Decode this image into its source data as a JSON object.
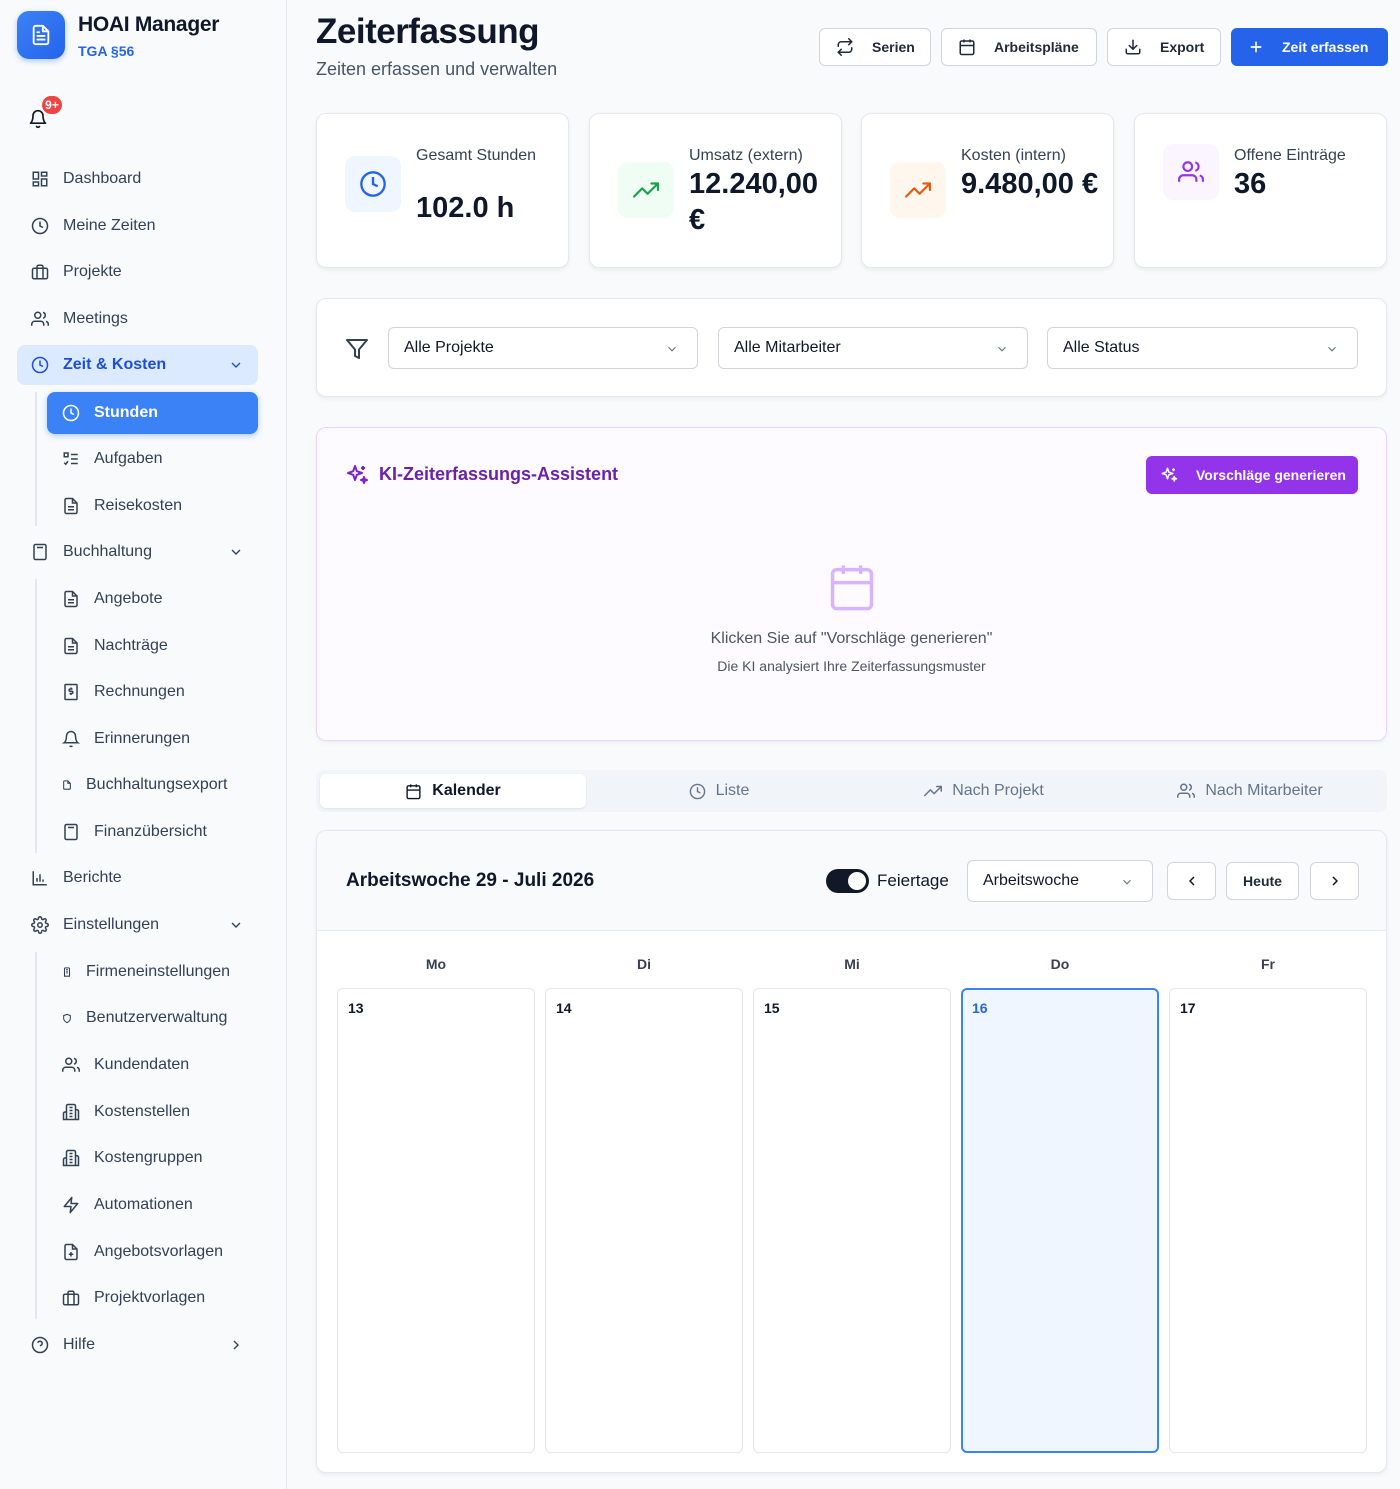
{
  "app": {
    "title": "HOAI Manager",
    "subtitle": "TGA §56",
    "notification_badge": "9+"
  },
  "sidebar": {
    "items": [
      {
        "label": "Dashboard",
        "icon": "dashboard-icon"
      },
      {
        "label": "Meine Zeiten",
        "icon": "clock-icon"
      },
      {
        "label": "Projekte",
        "icon": "briefcase-icon"
      },
      {
        "label": "Meetings",
        "icon": "users-icon"
      },
      {
        "label": "Zeit & Kosten",
        "icon": "clock-icon",
        "expanded": true
      },
      {
        "label": "Buchhaltung",
        "icon": "calculator-icon",
        "expanded": true
      },
      {
        "label": "Berichte",
        "icon": "bar-chart-icon"
      },
      {
        "label": "Einstellungen",
        "icon": "gear-icon",
        "expanded": true
      },
      {
        "label": "Hilfe",
        "icon": "help-icon"
      }
    ],
    "zeit_kosten": [
      "Stunden",
      "Aufgaben",
      "Reisekosten"
    ],
    "buchhaltung": [
      "Angebote",
      "Nachträge",
      "Rechnungen",
      "Erinnerungen",
      "Buchhaltungsexport",
      "Finanzübersicht"
    ],
    "einstellungen": [
      "Firmeneinstellungen",
      "Benutzerverwaltung",
      "Kundendaten",
      "Kostenstellen",
      "Kostengruppen",
      "Automationen",
      "Angebotsvorlagen",
      "Projektvorlagen"
    ],
    "active": "Stunden"
  },
  "header": {
    "title": "Zeiterfassung",
    "subtitle": "Zeiten erfassen und verwalten",
    "buttons": {
      "series": "Serien",
      "schedules": "Arbeitspläne",
      "export": "Export",
      "add": "Zeit erfassen"
    }
  },
  "stats": [
    {
      "label": "Gesamt Stunden",
      "value": "102.0 h",
      "color": "#2563eb"
    },
    {
      "label": "Umsatz (extern)",
      "value": "12.240,00 €",
      "color": "#16a34a"
    },
    {
      "label": "Kosten (intern)",
      "value": "9.480,00 €",
      "color": "#ea580c"
    },
    {
      "label": "Offene Einträge",
      "value": "36",
      "color": "#9333ea"
    }
  ],
  "filters": {
    "project": "Alle Projekte",
    "employee": "Alle Mitarbeiter",
    "status": "Alle Status"
  },
  "ai": {
    "title": "KI-Zeiterfassungs-Assistent",
    "button": "Vorschläge generieren",
    "empty_title": "Klicken Sie auf \"Vorschläge generieren\"",
    "empty_sub": "Die KI analysiert Ihre Zeiterfassungsmuster"
  },
  "tabs": [
    "Kalender",
    "Liste",
    "Nach Projekt",
    "Nach Mitarbeiter"
  ],
  "calendar": {
    "title": "Arbeitswoche 29 - Juli 2026",
    "holidays_label": "Feiertage",
    "holidays_on": true,
    "view": "Arbeitswoche",
    "today_label": "Heute",
    "days": [
      {
        "name": "Mo",
        "num": "13"
      },
      {
        "name": "Di",
        "num": "14"
      },
      {
        "name": "Mi",
        "num": "15"
      },
      {
        "name": "Do",
        "num": "16",
        "today": true
      },
      {
        "name": "Fr",
        "num": "17"
      }
    ]
  },
  "colors": {
    "primary": "#2563eb",
    "ai": "#9333ea",
    "active_nav": "#3b82f6"
  }
}
